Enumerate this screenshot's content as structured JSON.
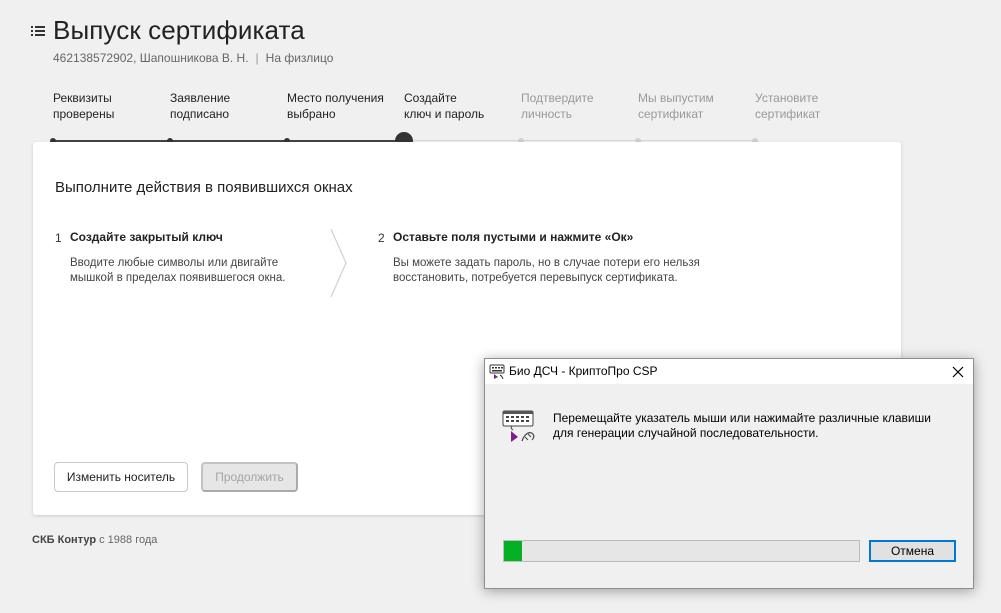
{
  "page": {
    "title": "Выпуск сертификата",
    "subtitle_id": "462138572902, Шапошникова В. Н.",
    "subtitle_sep": "|",
    "subtitle_type": "На физлицо"
  },
  "steps": [
    {
      "line1": "Реквизиты",
      "line2": "проверены",
      "state": "done"
    },
    {
      "line1": "Заявление",
      "line2": "подписано",
      "state": "done"
    },
    {
      "line1": "Место получения",
      "line2": "выбрано",
      "state": "done"
    },
    {
      "line1": "Создайте",
      "line2": "ключ и пароль",
      "state": "current"
    },
    {
      "line1": "Подтвердите",
      "line2": "личность",
      "state": "future"
    },
    {
      "line1": "Мы выпустим",
      "line2": "сертификат",
      "state": "future"
    },
    {
      "line1": "Установите",
      "line2": "сертификат",
      "state": "future"
    }
  ],
  "card": {
    "heading": "Выполните действия в появившихся окнах",
    "instructions": [
      {
        "num": "1",
        "title": "Создайте закрытый ключ",
        "desc_line1": "Вводите любые символы или двигайте",
        "desc_line2": "мышкой в пределах появившегося окна."
      },
      {
        "num": "2",
        "title": "Оставьте поля пустыми и нажмите «Ок»",
        "desc_line1": "Вы можете задать пароль, но в случае потери его нельзя",
        "desc_line2": "восстановить, потребуется перевыпуск сертификата."
      }
    ],
    "change_media_label": "Изменить носитель",
    "continue_label": "Продолжить"
  },
  "footer": {
    "brand": "СКБ Контур",
    "since": " с 1988 года"
  },
  "dialog": {
    "title": "Био ДСЧ - КриптоПро CSP",
    "message_line1": "Перемещайте указатель мыши или нажимайте различные клавиши",
    "message_line2": "для генерации случайной последовательности.",
    "progress_fraction": 0.05,
    "progress_color": "#06b025",
    "cancel_label": "Отмена"
  },
  "icons": [
    "menu-icon",
    "chevron-right-icon",
    "keyboard-mouse-icon",
    "close-icon"
  ]
}
